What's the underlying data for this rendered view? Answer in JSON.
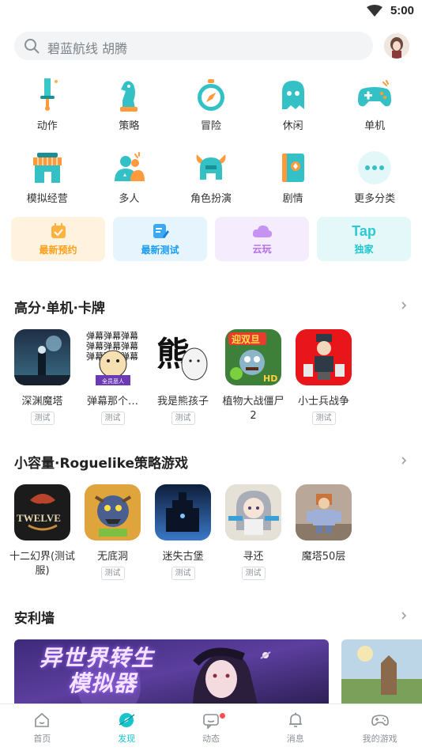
{
  "status": {
    "time": "5:00"
  },
  "search": {
    "placeholder": "碧蓝航线 胡腾"
  },
  "categories": [
    {
      "label": "动作",
      "icon": "sword-icon"
    },
    {
      "label": "策略",
      "icon": "chess-knight-icon"
    },
    {
      "label": "冒险",
      "icon": "compass-icon"
    },
    {
      "label": "休闲",
      "icon": "ghost-icon"
    },
    {
      "label": "单机",
      "icon": "gamepad-icon"
    },
    {
      "label": "模拟经营",
      "icon": "shop-icon"
    },
    {
      "label": "多人",
      "icon": "users-icon"
    },
    {
      "label": "角色扮演",
      "icon": "helmet-icon"
    },
    {
      "label": "剧情",
      "icon": "book-icon"
    },
    {
      "label": "更多分类",
      "icon": "more-icon"
    }
  ],
  "quick_tabs": [
    {
      "label": "最新预约",
      "color": "#ff9f1a",
      "bg": "#fff3e0"
    },
    {
      "label": "最新测试",
      "color": "#1a9df0",
      "bg": "#e6f4fd"
    },
    {
      "label": "云玩",
      "color": "#b26cf0",
      "bg": "#f5edfd"
    },
    {
      "label": "独家",
      "color": "#1fc5cf",
      "bg": "#e5f8f9",
      "logo": "Tap"
    }
  ],
  "sections": [
    {
      "title": "高分·单机·卡牌",
      "games": [
        {
          "name": "深渊魔塔",
          "tag": "测试"
        },
        {
          "name": "弹幕那个…",
          "tag": "测试"
        },
        {
          "name": "我是熊孩子",
          "tag": "测试"
        },
        {
          "name": "植物大战僵尸2",
          "tag": ""
        },
        {
          "name": "小士兵战争",
          "tag": "测试"
        }
      ]
    },
    {
      "title": "小容量·Roguelike策略游戏",
      "games": [
        {
          "name": "十二幻界(测试服)",
          "tag": ""
        },
        {
          "name": "无底洞",
          "tag": "测试"
        },
        {
          "name": "迷失古堡",
          "tag": "测试"
        },
        {
          "name": "寻还",
          "tag": "测试"
        },
        {
          "name": "魔塔50层",
          "tag": ""
        }
      ]
    },
    {
      "title": "安利墙"
    }
  ],
  "icon_text": {
    "g1b": "弹幕弹幕弹幕",
    "g1c": "熊",
    "g1d": "迎双旦",
    "g1d_badge": "HD",
    "g2a": "TWELVE",
    "g2b": "全员恶人"
  },
  "banner": {
    "title_line1": "异世界转生",
    "title_line2": "模拟器"
  },
  "nav": [
    {
      "label": "首页",
      "icon": "home-icon"
    },
    {
      "label": "发现",
      "icon": "discover-icon",
      "active": true
    },
    {
      "label": "动态",
      "icon": "chat-icon"
    },
    {
      "label": "消息",
      "icon": "bell-icon"
    },
    {
      "label": "我的游戏",
      "icon": "gamepad-icon"
    }
  ],
  "colors": {
    "accent": "#15c5ce"
  }
}
